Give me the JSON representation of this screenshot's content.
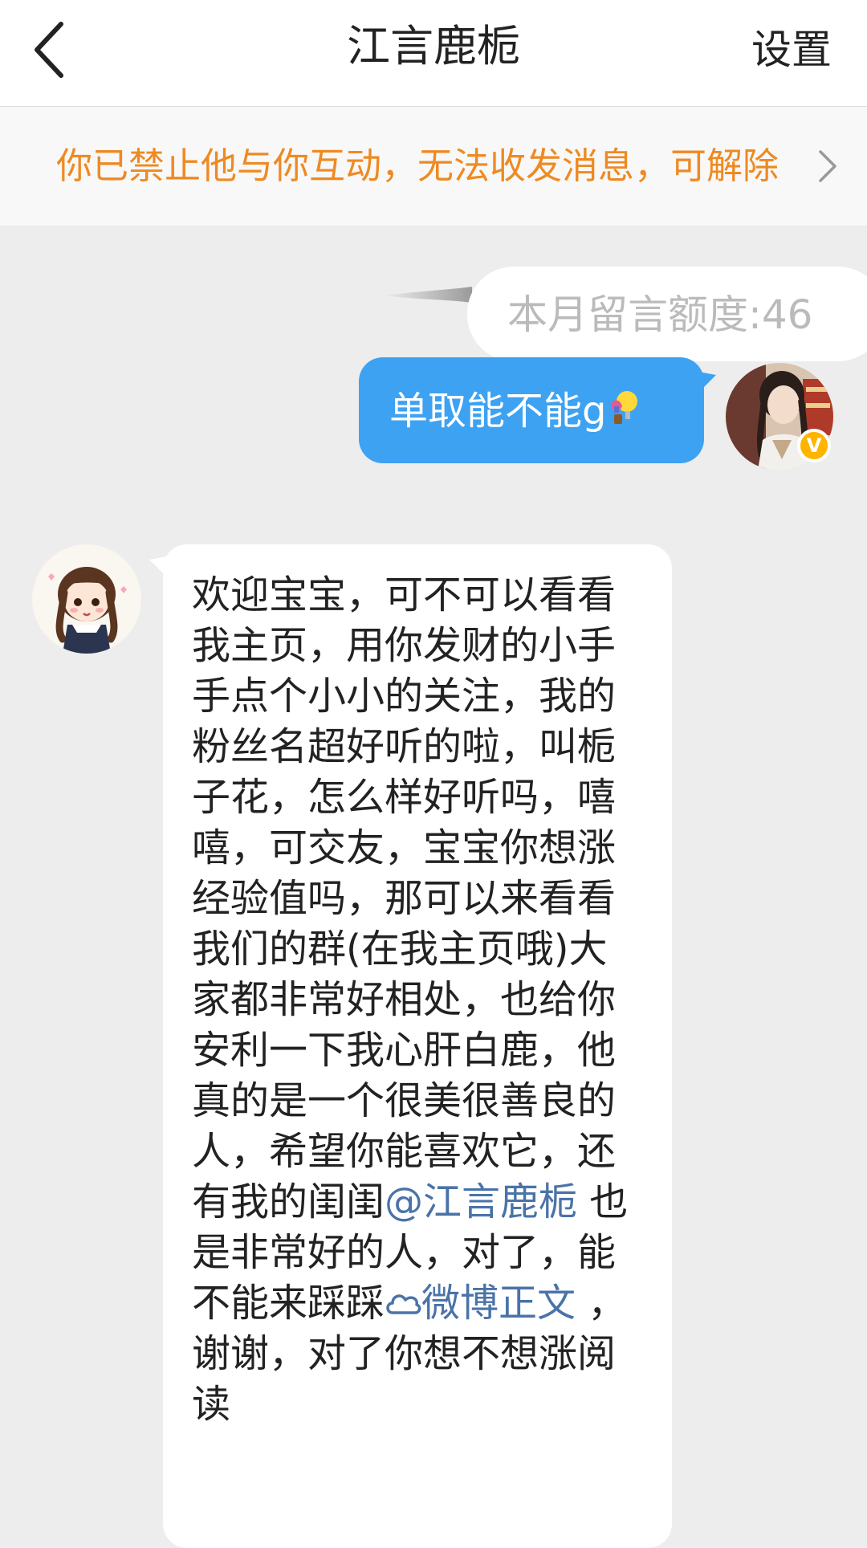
{
  "header": {
    "title": "江言鹿栀",
    "settings_label": "设置",
    "back_icon": "chevron-left-icon"
  },
  "notice": {
    "text": "你已禁止他与你互动，无法收发消息，可解除",
    "color": "#ee8a22",
    "chevron_icon": "chevron-right-icon"
  },
  "messages": {
    "quota_text": "本月留言额度:46",
    "sent": {
      "text": "单取能不能g",
      "emoji_icon": "hot-air-balloon-lightbulb-icon",
      "bubble_color": "#3ea2f2",
      "verified_badge": "V"
    },
    "received": {
      "text_part1": "欢迎宝宝，可不可以看看我主页，用你发财的小手手点个小小的关注，我的粉丝名超好听的啦，叫栀子花，怎么样好听吗，嘻嘻，可交友，宝宝你想涨经验值吗，那可以来看看我们的群(在我主页哦)大家都非常好相处，也给你安利一下我心肝白鹿，他真的是一个很美很善良的人，希望你能喜欢它，还有我的闺闺",
      "mention": "@江言鹿栀",
      "text_part2": " 也是非常好的人，对了，能不能来踩踩",
      "link_icon": "cloud-link-icon",
      "link_text": "微博正文",
      "text_part3": " ，谢谢，对了你想不想涨阅读"
    }
  },
  "colors": {
    "link": "#4a73a8",
    "background": "#ededed"
  }
}
